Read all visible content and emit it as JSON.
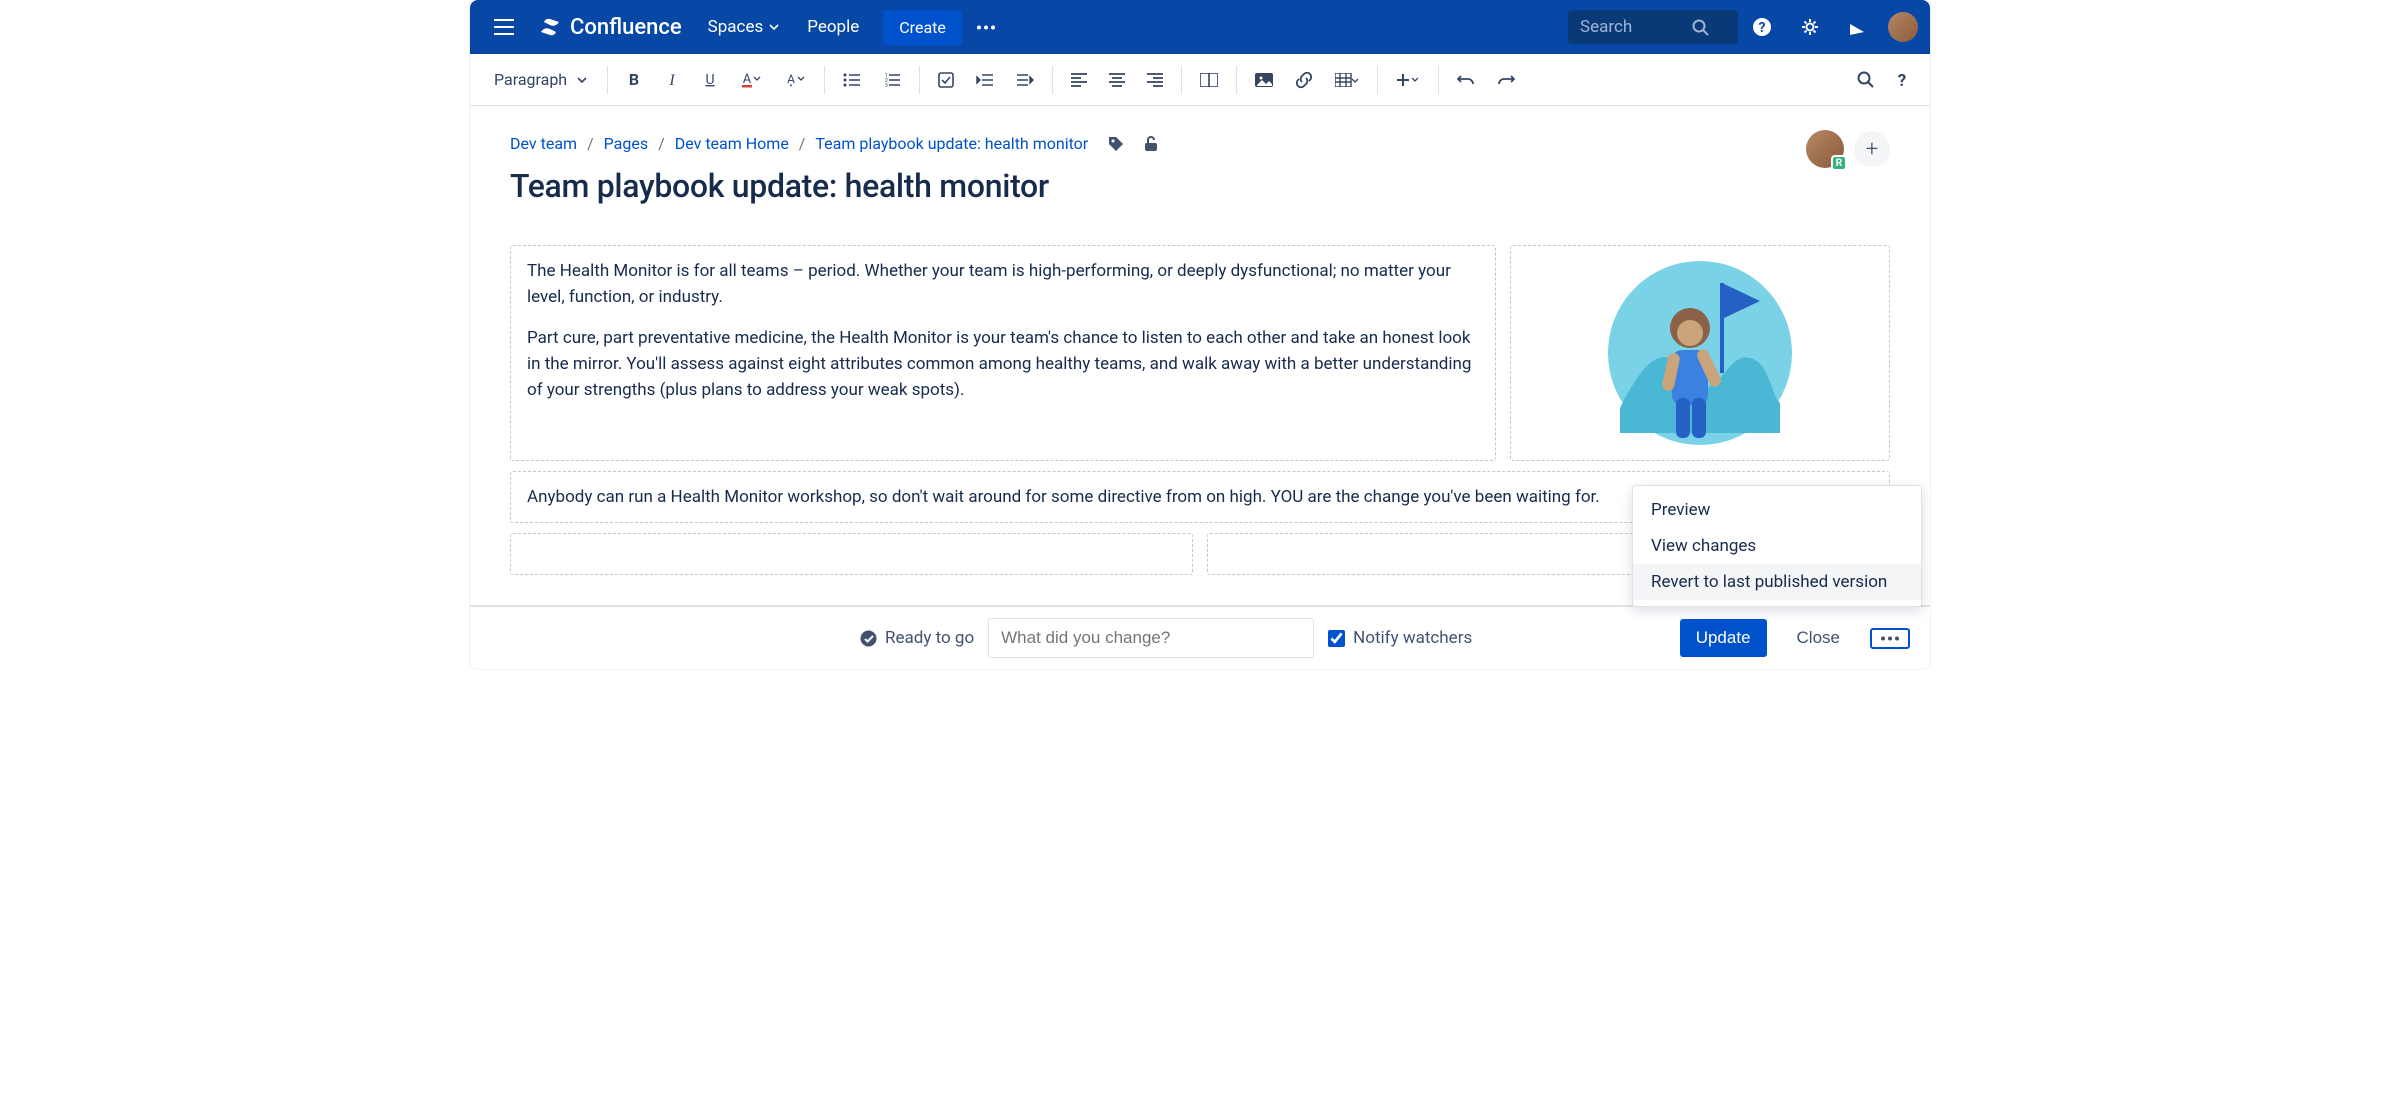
{
  "nav": {
    "brand": "Confluence",
    "items": {
      "spaces": "Spaces",
      "people": "People"
    },
    "create": "Create",
    "search_placeholder": "Search"
  },
  "toolbar": {
    "paragraph": "Paragraph"
  },
  "breadcrumb": {
    "items": [
      "Dev team",
      "Pages",
      "Dev team Home",
      "Team playbook update: health monitor"
    ]
  },
  "page": {
    "title": "Team playbook update: health monitor",
    "avatar_badge": "R",
    "para1": "The Health Monitor is for all teams – period. Whether your team is high-performing, or deeply dysfunctional; no matter your level, function, or industry.",
    "para2": "Part cure, part preventative medicine, the Health Monitor is your team's chance to listen to each other and take an honest look in the mirror. You'll assess against eight attributes common among healthy teams, and walk away with a better understanding of your strengths (plus plans to address your weak spots).",
    "para3": "Anybody can run a Health Monitor workshop, so don't wait around for some directive from on high. YOU are the change you've been waiting for."
  },
  "bottom": {
    "ready": "Ready to go",
    "change_placeholder": "What did you change?",
    "notify": "Notify watchers",
    "update": "Update",
    "close": "Close"
  },
  "dropdown": {
    "preview": "Preview",
    "view_changes": "View changes",
    "revert": "Revert to last published version"
  }
}
